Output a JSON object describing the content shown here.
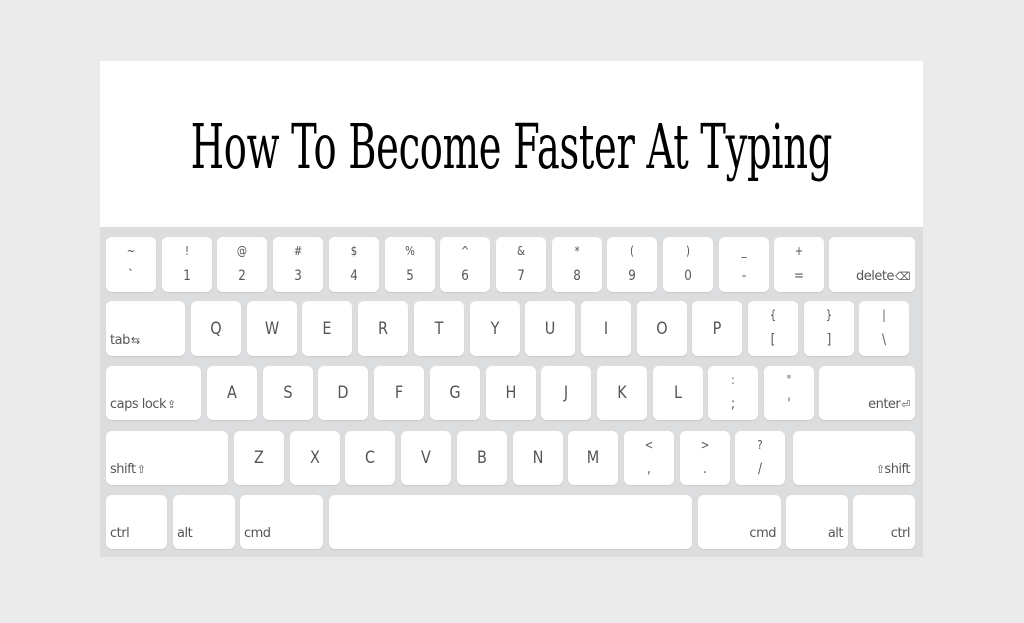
{
  "title": "How To Become Faster At Typing",
  "colors": {
    "page_bg": "#ebebeb",
    "keyboard_bg": "#dcdddf",
    "key_bg": "#ffffff",
    "key_text": "#555555",
    "title_text": "#000000"
  },
  "keyboard": {
    "row1": [
      {
        "top": "~",
        "bottom": "`"
      },
      {
        "top": "!",
        "bottom": "1"
      },
      {
        "top": "@",
        "bottom": "2"
      },
      {
        "top": "#",
        "bottom": "3"
      },
      {
        "top": "$",
        "bottom": "4"
      },
      {
        "top": "%",
        "bottom": "5"
      },
      {
        "top": "^",
        "bottom": "6"
      },
      {
        "top": "&",
        "bottom": "7"
      },
      {
        "top": "*",
        "bottom": "8"
      },
      {
        "top": "(",
        "bottom": "9"
      },
      {
        "top": ")",
        "bottom": "0"
      },
      {
        "top": "_",
        "bottom": "-"
      },
      {
        "top": "+",
        "bottom": "="
      }
    ],
    "delete": {
      "label": "delete",
      "icon": "⌫",
      "icon_name": "backspace-icon"
    },
    "tab": {
      "label": "tab",
      "icon": "⇆",
      "icon_name": "tab-arrows-icon"
    },
    "row2": [
      "Q",
      "W",
      "E",
      "R",
      "T",
      "Y",
      "U",
      "I",
      "O",
      "P"
    ],
    "row2_symbols": [
      {
        "top": "{",
        "bottom": "["
      },
      {
        "top": "}",
        "bottom": "]"
      },
      {
        "top": "|",
        "bottom": "\\"
      }
    ],
    "caps_lock": {
      "label": "caps lock",
      "icon": "⇪",
      "icon_name": "caps-lock-icon"
    },
    "row3": [
      "A",
      "S",
      "D",
      "F",
      "G",
      "H",
      "J",
      "K",
      "L"
    ],
    "row3_symbols": [
      {
        "top": ":",
        "bottom": ";"
      },
      {
        "top": "\"",
        "bottom": "'"
      }
    ],
    "enter": {
      "label": "enter",
      "icon": "⏎",
      "icon_name": "enter-icon"
    },
    "shift_left": {
      "label": "shift",
      "icon": "⇧",
      "icon_name": "shift-icon"
    },
    "row4": [
      "Z",
      "X",
      "C",
      "V",
      "B",
      "N",
      "M"
    ],
    "row4_symbols": [
      {
        "top": "<",
        "bottom": ","
      },
      {
        "top": ">",
        "bottom": "."
      },
      {
        "top": "?",
        "bottom": "/"
      }
    ],
    "shift_right": {
      "label": "shift",
      "icon": "⇧",
      "icon_name": "shift-icon"
    },
    "row5": {
      "ctrl_left": "ctrl",
      "alt_left": "alt",
      "cmd_left": "cmd",
      "space": "",
      "cmd_right": "cmd",
      "alt_right": "alt",
      "ctrl_right": "ctrl"
    }
  }
}
